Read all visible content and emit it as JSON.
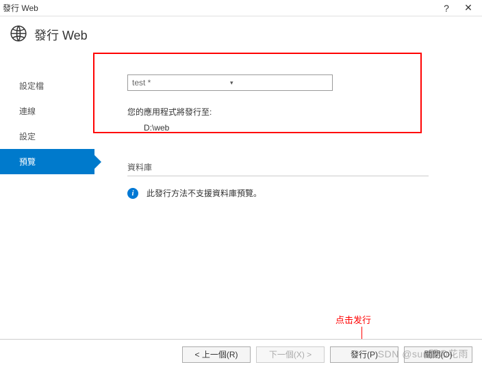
{
  "window": {
    "title": "發行 Web",
    "help_symbol": "?",
    "close_symbol": "✕"
  },
  "header": {
    "title": "發行 Web"
  },
  "sidebar": {
    "items": [
      {
        "label": "設定檔",
        "active": false
      },
      {
        "label": "連線",
        "active": false
      },
      {
        "label": "設定",
        "active": false
      },
      {
        "label": "預覽",
        "active": true
      }
    ]
  },
  "content": {
    "profile_dropdown": {
      "value": "test *"
    },
    "publish_label": "您的應用程式將發行至:",
    "publish_path": "D:\\web",
    "database_header": "資料庫",
    "database_info": "此發行方法不支援資料庫預覽。"
  },
  "annotation": {
    "text": "点击发行"
  },
  "footer": {
    "prev": "< 上一個(R)",
    "next": "下一個(X) >",
    "publish": "發行(P)",
    "close": "關閉(O)"
  },
  "watermark": "SDN @sun間の花雨"
}
